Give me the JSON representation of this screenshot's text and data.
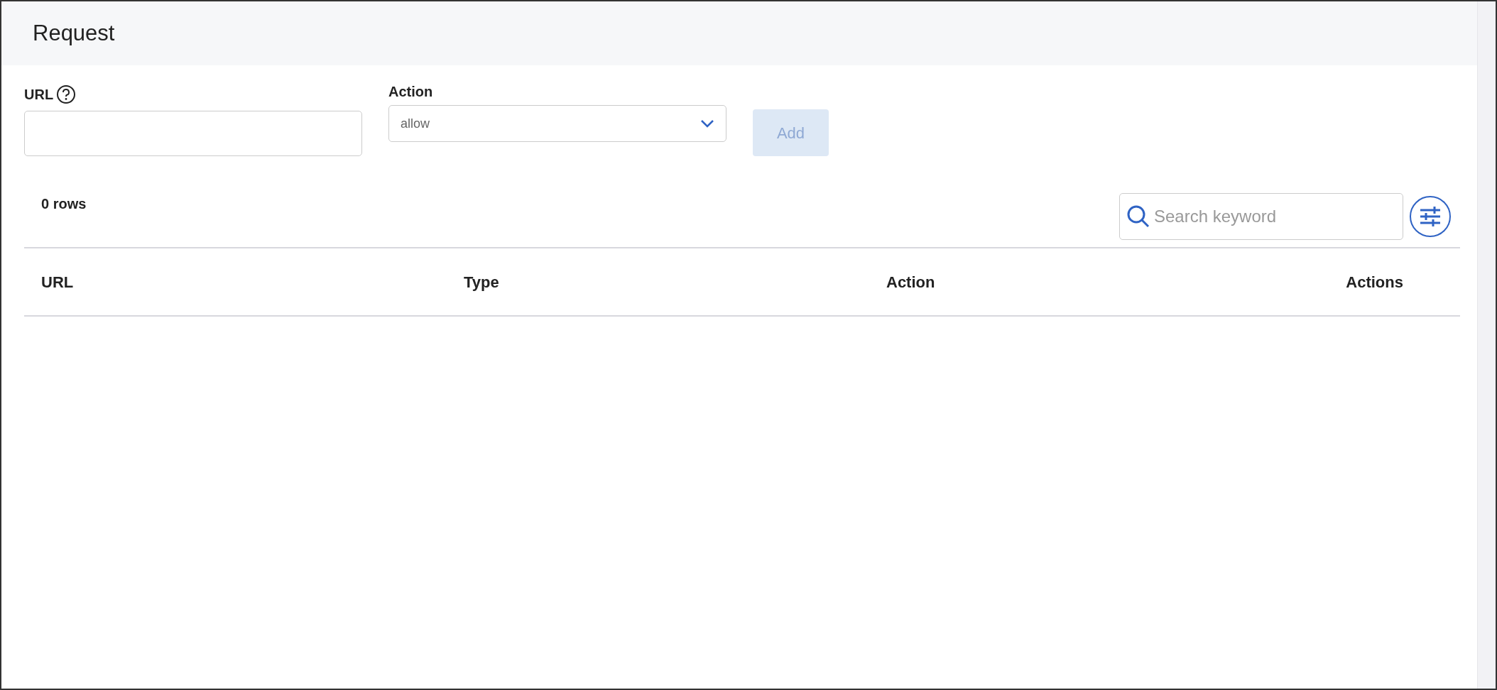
{
  "panel": {
    "title": "Request"
  },
  "form": {
    "url_label": "URL",
    "action_label": "Action",
    "action_value": "allow",
    "add_button": {
      "label": "Add",
      "disabled": true
    }
  },
  "table": {
    "row_count": "0 rows",
    "search": {
      "placeholder": "Search keyword"
    },
    "columns": [
      {
        "label": "URL"
      },
      {
        "label": "Type"
      },
      {
        "label": "Action"
      },
      {
        "label": "Actions"
      }
    ]
  }
}
